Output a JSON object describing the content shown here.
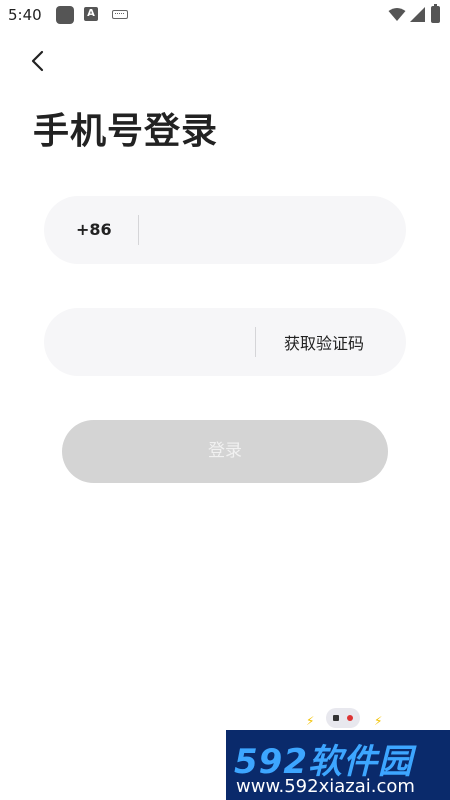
{
  "status_bar": {
    "time": "5:40",
    "a_glyph": "A",
    "icons": [
      "app-icon",
      "a-icon",
      "keyboard-icon",
      "wifi-icon",
      "signal-icon",
      "battery-icon"
    ]
  },
  "header": {
    "back_icon": "chevron-left-icon",
    "title": "手机号登录"
  },
  "phone": {
    "country_code": "+86",
    "value": "",
    "placeholder": ""
  },
  "code": {
    "value": "",
    "placeholder": "",
    "get_code_label": "获取验证码"
  },
  "login": {
    "label": "登录"
  },
  "watermark": {
    "title": "592软件园",
    "url": "www.592xiazai.com",
    "bg_color": "#0a2a6b",
    "title_color": "#3da6ff",
    "spark": "⚡"
  },
  "colors": {
    "field_bg": "#f6f6f8",
    "login_disabled_bg": "#d4d4d4",
    "text_primary": "#222222"
  }
}
